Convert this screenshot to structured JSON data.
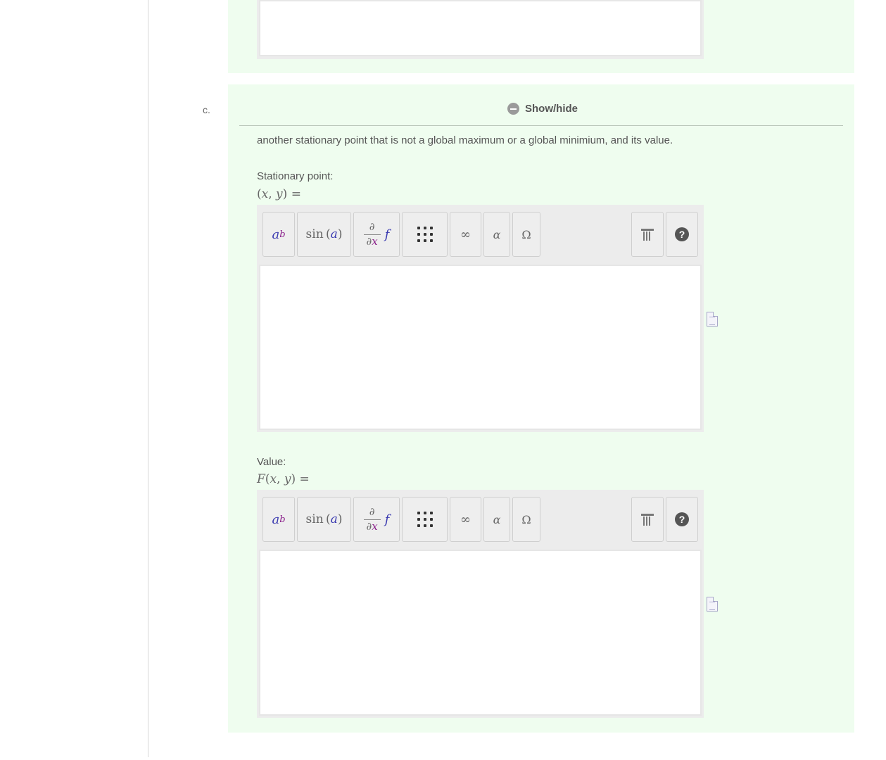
{
  "part": {
    "label": "c."
  },
  "section": {
    "toggle_label": "Show/hide",
    "prompt": "another stationary point that is not a global maximum or a global minimium, and its value."
  },
  "fields": [
    {
      "label": "Stationary point:",
      "math_label": "(x, y) =",
      "toolbar": {
        "power": "a^b",
        "function": "sin(a)",
        "derivative": "∂/∂x f",
        "matrix": "⋮⋮⋮",
        "infinity": "∞",
        "greek": "α",
        "symbols": "Ω",
        "clear": "trash",
        "help": "?"
      },
      "value": ""
    },
    {
      "label": "Value:",
      "math_label": "F(x, y) =",
      "toolbar": {
        "power": "a^b",
        "function": "sin(a)",
        "derivative": "∂/∂x f",
        "matrix": "⋮⋮⋮",
        "infinity": "∞",
        "greek": "α",
        "symbols": "Ω",
        "clear": "trash",
        "help": "?"
      },
      "value": ""
    }
  ],
  "colors": {
    "panel_bg": "#effdef",
    "toolbar_bg": "#ececec",
    "accent_blue": "#3a3ab0",
    "accent_purple": "#8a1e8a"
  },
  "icons": [
    "minus-circle-icon",
    "trash-icon",
    "help-icon",
    "document-icon"
  ]
}
